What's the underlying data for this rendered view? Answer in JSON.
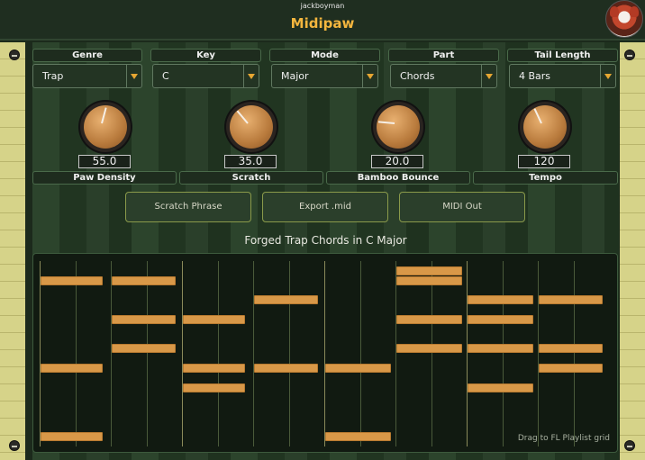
{
  "header": {
    "author": "jackboyman",
    "title": "Midipaw"
  },
  "controls": [
    {
      "label": "Genre",
      "value": "Trap"
    },
    {
      "label": "Key",
      "value": "C"
    },
    {
      "label": "Mode",
      "value": "Major"
    },
    {
      "label": "Part",
      "value": "Chords"
    },
    {
      "label": "Tail Length",
      "value": "4 Bars"
    }
  ],
  "knobs": [
    {
      "label": "Paw Density",
      "value": "55.0",
      "angle": 15
    },
    {
      "label": "Scratch",
      "value": "35.0",
      "angle": -40
    },
    {
      "label": "Bamboo Bounce",
      "value": "20.0",
      "angle": -85
    },
    {
      "label": "Tempo",
      "value": "120",
      "angle": -25
    }
  ],
  "buttons": {
    "scratch": "Scratch Phrase",
    "export": "Export .mid",
    "midi": "MIDI Out"
  },
  "roll": {
    "title": "Forged Trap Chords in C Major",
    "hint": "Drag to FL Playlist grid"
  }
}
